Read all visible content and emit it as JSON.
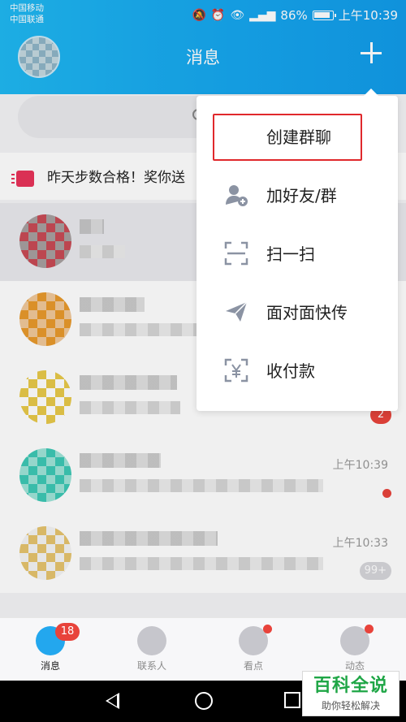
{
  "status_bar": {
    "carrier_1": "中国移动",
    "carrier_2": "中国联通",
    "battery": "86%",
    "time": "上午10:39"
  },
  "header": {
    "title": "消息"
  },
  "banner": {
    "text": "昨天步数合格！奖你送"
  },
  "menu": {
    "items": [
      {
        "label": "创建群聊",
        "icon": "group-chat-plus-icon"
      },
      {
        "label": "加好友/群",
        "icon": "add-friend-icon"
      },
      {
        "label": "扫一扫",
        "icon": "scan-icon"
      },
      {
        "label": "面对面快传",
        "icon": "paper-plane-icon"
      },
      {
        "label": "收付款",
        "icon": "payment-scan-icon"
      }
    ]
  },
  "conversations": [
    {
      "time": "",
      "unread": ""
    },
    {
      "time": "",
      "unread": ""
    },
    {
      "time": "",
      "unread": "2"
    },
    {
      "time": "上午10:39",
      "unread": ""
    },
    {
      "time": "上午10:33",
      "unread": "99+"
    }
  ],
  "tabs": [
    {
      "label": "消息",
      "badge": "18"
    },
    {
      "label": "联系人",
      "badge": ""
    },
    {
      "label": "看点",
      "badge": ""
    },
    {
      "label": "动态",
      "badge": ""
    }
  ],
  "watermark": {
    "main": "百科全说",
    "sub": "助你轻松解决"
  },
  "colors": {
    "header": "#17a8ef",
    "badge": "#e8433b",
    "highlight": "#e0282c"
  }
}
